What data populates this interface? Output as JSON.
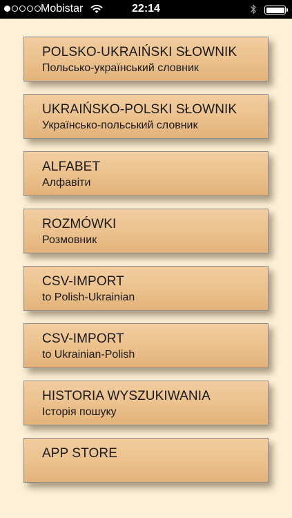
{
  "status_bar": {
    "carrier": "Mobistar",
    "time": "22:14",
    "signal_bars_filled": 1,
    "signal_bars_total": 5,
    "battery_level": 1.0
  },
  "menu": {
    "items": [
      {
        "title": "POLSKO-UKRAIŃSKI SŁOWNIK",
        "subtitle": "Польсько-український словник"
      },
      {
        "title": "UKRAIŃSKO-POLSKI SŁOWNIK",
        "subtitle": "Українсько-польський словник"
      },
      {
        "title": "ALFABET",
        "subtitle": "Алфавіти"
      },
      {
        "title": "ROZMÓWKI",
        "subtitle": "Розмовник"
      },
      {
        "title": "CSV-IMPORT",
        "subtitle": "to Polish-Ukrainian"
      },
      {
        "title": "CSV-IMPORT",
        "subtitle": "to Ukrainian-Polish"
      },
      {
        "title": "HISTORIA WYSZUKIWANIA",
        "subtitle": "Історія пошуку"
      },
      {
        "title": "APP STORE",
        "subtitle": ""
      }
    ]
  },
  "colors": {
    "background": "#fdf0d6",
    "button_top": "#f2cda0",
    "button_bottom": "#e3b27b",
    "button_border": "#8e8e8e",
    "text": "#1a1a1a"
  },
  "icons": {
    "wifi": "wifi-icon",
    "bluetooth": "bluetooth-icon",
    "battery": "battery-icon",
    "signal": "signal-strength-icon"
  }
}
